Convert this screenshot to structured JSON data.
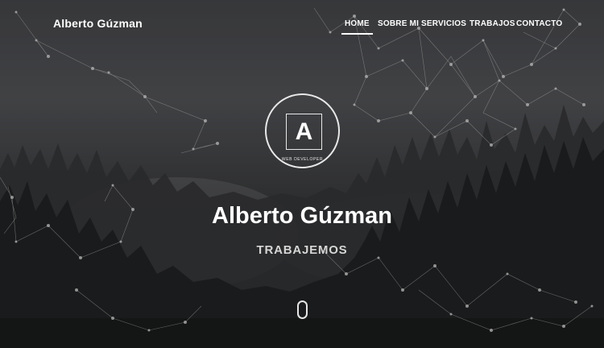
{
  "brand": {
    "name": "Alberto Gúzman"
  },
  "nav": {
    "items": [
      {
        "label": "HOME",
        "active": true
      },
      {
        "label": "SOBRE MI",
        "active": false
      },
      {
        "label": "SERVICIOS",
        "active": false
      },
      {
        "label": "TRABAJOS",
        "active": false
      },
      {
        "label": "CONTACTO",
        "active": false
      }
    ]
  },
  "hero": {
    "logo_letter": "A",
    "logo_caption": "WEB DEVELOPER",
    "title": "Alberto Gúzman",
    "subtitle": "TRABAJEMOS"
  },
  "icons": {
    "scroll": "mouse-scroll-icon",
    "background": "network-particles-over-forest"
  },
  "colors": {
    "text": "#ffffff",
    "subtitle": "#d6d6d6",
    "overlay": "#3e3f42"
  }
}
